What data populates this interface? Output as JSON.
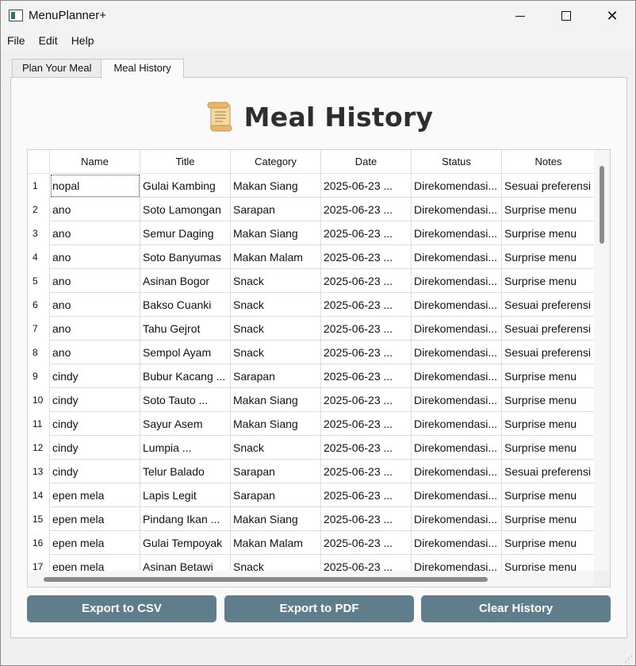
{
  "window": {
    "title": "MenuPlanner+"
  },
  "menubar": [
    "File",
    "Edit",
    "Help"
  ],
  "tabs": [
    {
      "label": "Plan Your Meal",
      "active": false
    },
    {
      "label": "Meal History",
      "active": true
    }
  ],
  "page": {
    "heading": "Meal History",
    "heading_icon": "scroll-icon"
  },
  "table": {
    "columns": [
      "Name",
      "Title",
      "Category",
      "Date",
      "Status",
      "Notes"
    ],
    "rows": [
      [
        "1",
        "nopal",
        "Gulai Kambing",
        "Makan Siang",
        "2025-06-23 ...",
        "Direkomendasi...",
        "Sesuai preferensi"
      ],
      [
        "2",
        "ano",
        "Soto Lamongan",
        "Sarapan",
        "2025-06-23 ...",
        "Direkomendasi...",
        "Surprise menu"
      ],
      [
        "3",
        "ano",
        "Semur Daging",
        "Makan Siang",
        "2025-06-23 ...",
        "Direkomendasi...",
        "Surprise menu"
      ],
      [
        "4",
        "ano",
        "Soto Banyumas",
        "Makan Malam",
        "2025-06-23 ...",
        "Direkomendasi...",
        "Surprise menu"
      ],
      [
        "5",
        "ano",
        "Asinan Bogor",
        "Snack",
        "2025-06-23 ...",
        "Direkomendasi...",
        "Surprise menu"
      ],
      [
        "6",
        "ano",
        "Bakso Cuanki",
        "Snack",
        "2025-06-23 ...",
        "Direkomendasi...",
        "Sesuai preferensi"
      ],
      [
        "7",
        "ano",
        "Tahu Gejrot",
        "Snack",
        "2025-06-23 ...",
        "Direkomendasi...",
        "Sesuai preferensi"
      ],
      [
        "8",
        "ano",
        "Sempol Ayam",
        "Snack",
        "2025-06-23 ...",
        "Direkomendasi...",
        "Sesuai preferensi"
      ],
      [
        "9",
        "cindy",
        "Bubur Kacang ...",
        "Sarapan",
        "2025-06-23 ...",
        "Direkomendasi...",
        "Surprise menu"
      ],
      [
        "10",
        "cindy",
        "Soto Tauto ...",
        "Makan Siang",
        "2025-06-23 ...",
        "Direkomendasi...",
        "Surprise menu"
      ],
      [
        "11",
        "cindy",
        "Sayur Asem",
        "Makan Siang",
        "2025-06-23 ...",
        "Direkomendasi...",
        "Surprise menu"
      ],
      [
        "12",
        "cindy",
        "Lumpia ...",
        "Snack",
        "2025-06-23 ...",
        "Direkomendasi...",
        "Surprise menu"
      ],
      [
        "13",
        "cindy",
        "Telur Balado",
        "Sarapan",
        "2025-06-23 ...",
        "Direkomendasi...",
        "Sesuai preferensi"
      ],
      [
        "14",
        "epen mela",
        "Lapis Legit",
        "Sarapan",
        "2025-06-23 ...",
        "Direkomendasi...",
        "Surprise menu"
      ],
      [
        "15",
        "epen mela",
        "Pindang Ikan ...",
        "Makan Siang",
        "2025-06-23 ...",
        "Direkomendasi...",
        "Surprise menu"
      ],
      [
        "16",
        "epen mela",
        "Gulai Tempoyak",
        "Makan Malam",
        "2025-06-23 ...",
        "Direkomendasi...",
        "Surprise menu"
      ],
      [
        "17",
        "epen mela",
        "Asinan Betawi",
        "Snack",
        "2025-06-23 ...",
        "Direkomendasi...",
        "Surprise menu"
      ]
    ]
  },
  "buttons": {
    "export_csv": "Export to CSV",
    "export_pdf": "Export to PDF",
    "clear_history": "Clear History"
  },
  "colors": {
    "button_bg": "#607d8b",
    "heading": "#2e2e2e"
  }
}
